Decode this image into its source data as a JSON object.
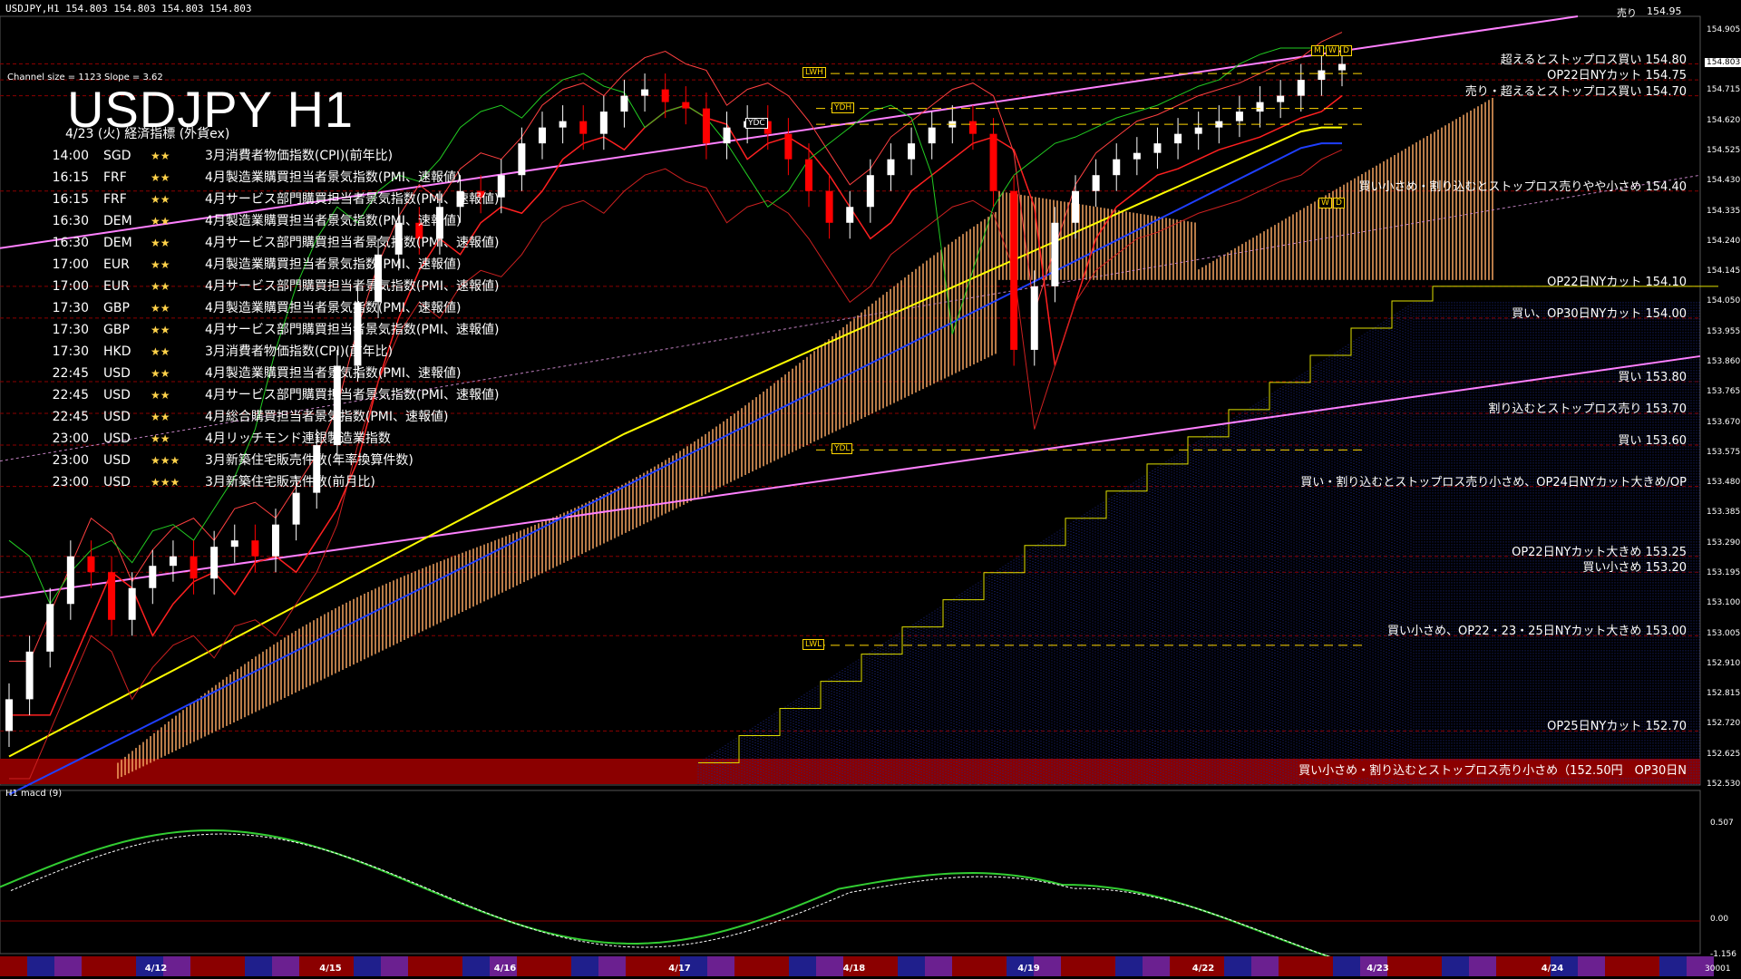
{
  "header": {
    "symbol_line": "USDJPY,H1  154.803 154.803 154.803 154.803",
    "channel_info": "Channel size = 1123 Slope = 3.62",
    "big_title": "USDJPY H1",
    "subtitle": "4/23 (火) 経済指標 (外貨ex)",
    "top_right_1": "売り",
    "top_right_2": "154.95"
  },
  "events": [
    {
      "time": "14:00",
      "ccy": "SGD",
      "stars": "★★",
      "name": "3月消費者物価指数(CPI)(前年比)"
    },
    {
      "time": "16:15",
      "ccy": "FRF",
      "stars": "★★",
      "name": "4月製造業購買担当者景気指数(PMI、速報値)"
    },
    {
      "time": "16:15",
      "ccy": "FRF",
      "stars": "★★",
      "name": "4月サービス部門購買担当者景気指数(PMI、速報値)"
    },
    {
      "time": "16:30",
      "ccy": "DEM",
      "stars": "★★",
      "name": "4月製造業購買担当者景気指数(PMI、速報値)"
    },
    {
      "time": "16:30",
      "ccy": "DEM",
      "stars": "★★",
      "name": "4月サービス部門購買担当者景気指数(PMI、速報値)"
    },
    {
      "time": "17:00",
      "ccy": "EUR",
      "stars": "★★",
      "name": "4月製造業購買担当者景気指数(PMI、速報値)"
    },
    {
      "time": "17:00",
      "ccy": "EUR",
      "stars": "★★",
      "name": "4月サービス部門購買担当者景気指数(PMI、速報値)"
    },
    {
      "time": "17:30",
      "ccy": "GBP",
      "stars": "★★",
      "name": "4月製造業購買担当者景気指数(PMI、速報値)"
    },
    {
      "time": "17:30",
      "ccy": "GBP",
      "stars": "★★",
      "name": "4月サービス部門購買担当者景気指数(PMI、速報値)"
    },
    {
      "time": "17:30",
      "ccy": "HKD",
      "stars": "★★",
      "name": "3月消費者物価指数(CPI)(前年比)"
    },
    {
      "time": "22:45",
      "ccy": "USD",
      "stars": "★★",
      "name": "4月製造業購買担当者景気指数(PMI、速報値)"
    },
    {
      "time": "22:45",
      "ccy": "USD",
      "stars": "★★",
      "name": "4月サービス部門購買担当者景気指数(PMI、速報値)"
    },
    {
      "time": "22:45",
      "ccy": "USD",
      "stars": "★★",
      "name": "4月総合購買担当者景気指数(PMI、速報値)"
    },
    {
      "time": "23:00",
      "ccy": "USD",
      "stars": "★★",
      "name": "4月リッチモンド連銀製造業指数"
    },
    {
      "time": "23:00",
      "ccy": "USD",
      "stars": "★★★",
      "name": "3月新築住宅販売件数(年率換算件数)"
    },
    {
      "time": "23:00",
      "ccy": "USD",
      "stars": "★★★",
      "name": "3月新築住宅販売件数(前月比)"
    }
  ],
  "annotations": [
    {
      "price": 154.8,
      "text": "超えるとストップロス買い 154.80"
    },
    {
      "price": 154.75,
      "text": "OP22日NYカット 154.75"
    },
    {
      "price": 154.7,
      "text": "売り・超えるとストップロス買い 154.70"
    },
    {
      "price": 154.4,
      "text": "買い小さめ・割り込むとストップロス売りやや小さめ 154.40"
    },
    {
      "price": 154.1,
      "text": "OP22日NYカット 154.10"
    },
    {
      "price": 154.0,
      "text": "買い、OP30日NYカット 154.00"
    },
    {
      "price": 153.8,
      "text": "買い 153.80"
    },
    {
      "price": 153.7,
      "text": "割り込むとストップロス売り 153.70"
    },
    {
      "price": 153.6,
      "text": "買い 153.60"
    },
    {
      "price": 153.47,
      "text": "買い・割り込むとストップロス売り小さめ、OP24日NYカット大きめ/OP"
    },
    {
      "price": 153.25,
      "text": "OP22日NYカット大きめ 153.25"
    },
    {
      "price": 153.2,
      "text": "買い小さめ 153.20"
    },
    {
      "price": 153.0,
      "text": "買い小さめ、OP22・23・25日NYカット大きめ 153.00"
    },
    {
      "price": 152.7,
      "text": "OP25日NYカット 152.70"
    },
    {
      "price": 152.56,
      "text": "買い小さめ・割り込むとストップロス売り小さめ（152.50円　OP30日N"
    }
  ],
  "price_axis": [
    "154.905",
    "154.803",
    "154.715",
    "154.620",
    "154.525",
    "154.430",
    "154.335",
    "154.240",
    "154.145",
    "154.050",
    "153.955",
    "153.860",
    "153.765",
    "153.670",
    "153.575",
    "153.480",
    "153.385",
    "153.290",
    "153.195",
    "153.100",
    "153.005",
    "152.910",
    "152.815",
    "152.720",
    "152.625",
    "152.530"
  ],
  "current_price": "154.803",
  "macd_axis": [
    "0.507",
    "0.00",
    "-1.156"
  ],
  "macd_label": "H1  macd (9)",
  "volume_label": "30001",
  "level_tags": [
    {
      "label": "LWH",
      "price": 154.77
    },
    {
      "label": "YDH",
      "price": 154.66
    },
    {
      "label": "YDC",
      "price": 154.61
    },
    {
      "label": "YDL",
      "price": 153.585
    },
    {
      "label": "LWL",
      "price": 152.97
    },
    {
      "label": "M",
      "price": 154.84
    },
    {
      "label": "W",
      "price": 154.84
    },
    {
      "label": "D",
      "price": 154.84
    },
    {
      "label": "W",
      "price": 154.36
    },
    {
      "label": "D",
      "price": 154.36
    }
  ],
  "colors": {
    "candle_up": "#ffffff",
    "candle_down": "#ff0000",
    "kumo_up": "#f4a460",
    "kumo_down": "#1e2a8c",
    "ma_fast": "#ffff00",
    "ma_slow": "#1f3fff",
    "channel": "#ff80ff",
    "macd": "#32cd32",
    "signal": "#ffffff",
    "grid_red": "#8b0000"
  },
  "chart_data": {
    "type": "candlestick",
    "symbol": "USDJPY",
    "timeframe": "H1",
    "x_dates": [
      "4/12",
      "4/15",
      "4/16",
      "4/17",
      "4/18",
      "4/19",
      "4/22",
      "4/23",
      "4/24"
    ],
    "ylim": [
      152.53,
      154.95
    ],
    "closes": [
      152.8,
      152.95,
      153.1,
      153.25,
      153.2,
      153.05,
      153.15,
      153.22,
      153.25,
      153.18,
      153.28,
      153.3,
      153.25,
      153.35,
      153.45,
      153.6,
      153.85,
      154.05,
      154.2,
      154.3,
      154.25,
      154.35,
      154.4,
      154.38,
      154.45,
      154.55,
      154.6,
      154.62,
      154.58,
      154.65,
      154.7,
      154.72,
      154.68,
      154.66,
      154.55,
      154.6,
      154.62,
      154.58,
      154.5,
      154.4,
      154.3,
      154.35,
      154.45,
      154.5,
      154.55,
      154.6,
      154.62,
      154.58,
      154.4,
      153.9,
      154.1,
      154.3,
      154.4,
      154.45,
      154.5,
      154.52,
      154.55,
      154.58,
      154.6,
      154.62,
      154.65,
      154.68,
      154.7,
      154.75,
      154.78,
      154.8
    ]
  }
}
